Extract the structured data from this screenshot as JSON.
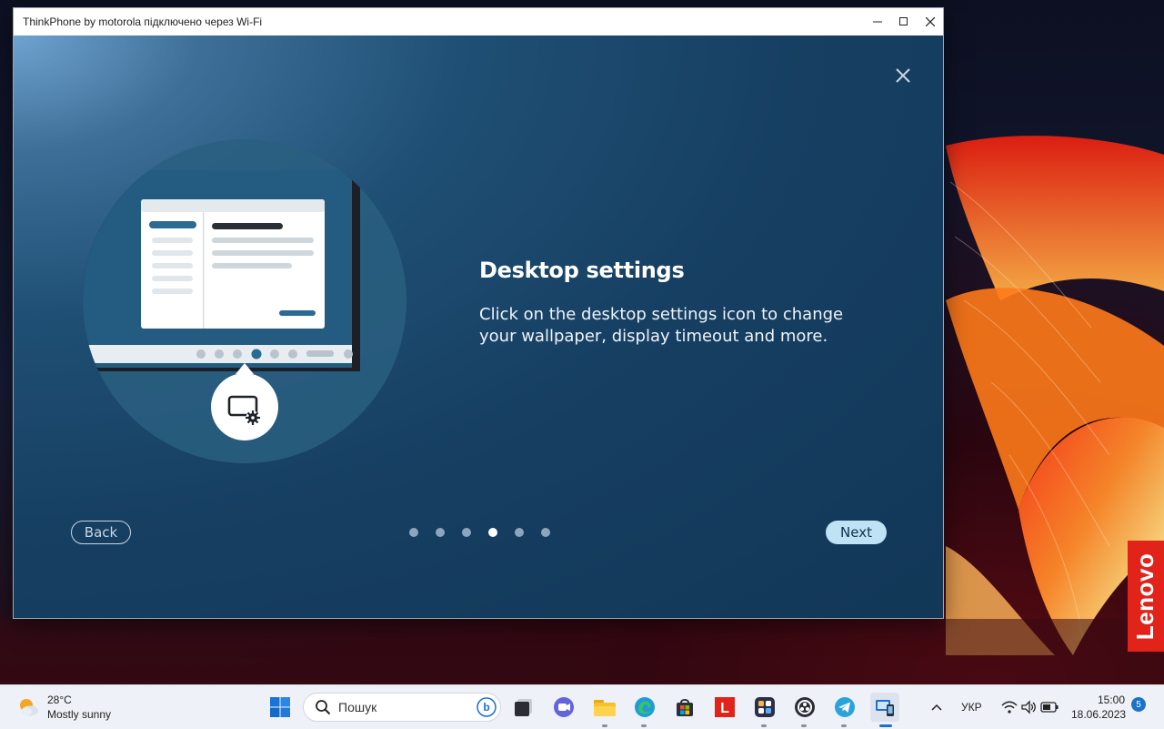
{
  "window": {
    "title": "ThinkPhone by motorola підключено через Wi-Fi"
  },
  "onboarding": {
    "heading": "Desktop settings",
    "description": "Click on the desktop settings icon to change your wallpaper, display timeout and more.",
    "back_label": "Back",
    "next_label": "Next",
    "page_dots_total": 6,
    "page_dots_active": 4
  },
  "wallpaper": {
    "brand_label": "Lenovo"
  },
  "taskbar": {
    "weather_temp": "28°C",
    "weather_desc": "Mostly sunny",
    "search_placeholder": "Пошук",
    "apps": [
      "start-icon",
      "task-view-icon",
      "chat-icon",
      "file-explorer-icon",
      "edge-icon",
      "store-icon",
      "lenovo-l-icon",
      "app-grid-icon",
      "obs-icon",
      "telegram-icon",
      "phone-link-icon"
    ],
    "language": "УКР",
    "time": "15:00",
    "date": "18.06.2023",
    "notification_count": "5"
  },
  "colors": {
    "accent": "#bfe3f5",
    "lenovo_red": "#e2231a",
    "panel_dark": "#123757"
  }
}
